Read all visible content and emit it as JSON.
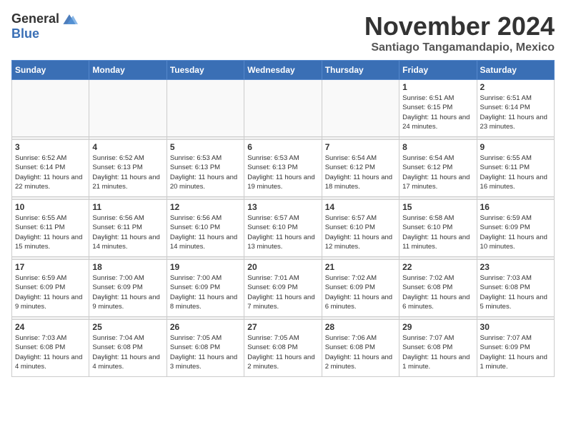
{
  "header": {
    "logo_general": "General",
    "logo_blue": "Blue",
    "month_title": "November 2024",
    "location": "Santiago Tangamandapio, Mexico"
  },
  "weekdays": [
    "Sunday",
    "Monday",
    "Tuesday",
    "Wednesday",
    "Thursday",
    "Friday",
    "Saturday"
  ],
  "weeks": [
    [
      {
        "day": "",
        "info": ""
      },
      {
        "day": "",
        "info": ""
      },
      {
        "day": "",
        "info": ""
      },
      {
        "day": "",
        "info": ""
      },
      {
        "day": "",
        "info": ""
      },
      {
        "day": "1",
        "info": "Sunrise: 6:51 AM\nSunset: 6:15 PM\nDaylight: 11 hours and 24 minutes."
      },
      {
        "day": "2",
        "info": "Sunrise: 6:51 AM\nSunset: 6:14 PM\nDaylight: 11 hours and 23 minutes."
      }
    ],
    [
      {
        "day": "3",
        "info": "Sunrise: 6:52 AM\nSunset: 6:14 PM\nDaylight: 11 hours and 22 minutes."
      },
      {
        "day": "4",
        "info": "Sunrise: 6:52 AM\nSunset: 6:13 PM\nDaylight: 11 hours and 21 minutes."
      },
      {
        "day": "5",
        "info": "Sunrise: 6:53 AM\nSunset: 6:13 PM\nDaylight: 11 hours and 20 minutes."
      },
      {
        "day": "6",
        "info": "Sunrise: 6:53 AM\nSunset: 6:13 PM\nDaylight: 11 hours and 19 minutes."
      },
      {
        "day": "7",
        "info": "Sunrise: 6:54 AM\nSunset: 6:12 PM\nDaylight: 11 hours and 18 minutes."
      },
      {
        "day": "8",
        "info": "Sunrise: 6:54 AM\nSunset: 6:12 PM\nDaylight: 11 hours and 17 minutes."
      },
      {
        "day": "9",
        "info": "Sunrise: 6:55 AM\nSunset: 6:11 PM\nDaylight: 11 hours and 16 minutes."
      }
    ],
    [
      {
        "day": "10",
        "info": "Sunrise: 6:55 AM\nSunset: 6:11 PM\nDaylight: 11 hours and 15 minutes."
      },
      {
        "day": "11",
        "info": "Sunrise: 6:56 AM\nSunset: 6:11 PM\nDaylight: 11 hours and 14 minutes."
      },
      {
        "day": "12",
        "info": "Sunrise: 6:56 AM\nSunset: 6:10 PM\nDaylight: 11 hours and 14 minutes."
      },
      {
        "day": "13",
        "info": "Sunrise: 6:57 AM\nSunset: 6:10 PM\nDaylight: 11 hours and 13 minutes."
      },
      {
        "day": "14",
        "info": "Sunrise: 6:57 AM\nSunset: 6:10 PM\nDaylight: 11 hours and 12 minutes."
      },
      {
        "day": "15",
        "info": "Sunrise: 6:58 AM\nSunset: 6:10 PM\nDaylight: 11 hours and 11 minutes."
      },
      {
        "day": "16",
        "info": "Sunrise: 6:59 AM\nSunset: 6:09 PM\nDaylight: 11 hours and 10 minutes."
      }
    ],
    [
      {
        "day": "17",
        "info": "Sunrise: 6:59 AM\nSunset: 6:09 PM\nDaylight: 11 hours and 9 minutes."
      },
      {
        "day": "18",
        "info": "Sunrise: 7:00 AM\nSunset: 6:09 PM\nDaylight: 11 hours and 9 minutes."
      },
      {
        "day": "19",
        "info": "Sunrise: 7:00 AM\nSunset: 6:09 PM\nDaylight: 11 hours and 8 minutes."
      },
      {
        "day": "20",
        "info": "Sunrise: 7:01 AM\nSunset: 6:09 PM\nDaylight: 11 hours and 7 minutes."
      },
      {
        "day": "21",
        "info": "Sunrise: 7:02 AM\nSunset: 6:09 PM\nDaylight: 11 hours and 6 minutes."
      },
      {
        "day": "22",
        "info": "Sunrise: 7:02 AM\nSunset: 6:08 PM\nDaylight: 11 hours and 6 minutes."
      },
      {
        "day": "23",
        "info": "Sunrise: 7:03 AM\nSunset: 6:08 PM\nDaylight: 11 hours and 5 minutes."
      }
    ],
    [
      {
        "day": "24",
        "info": "Sunrise: 7:03 AM\nSunset: 6:08 PM\nDaylight: 11 hours and 4 minutes."
      },
      {
        "day": "25",
        "info": "Sunrise: 7:04 AM\nSunset: 6:08 PM\nDaylight: 11 hours and 4 minutes."
      },
      {
        "day": "26",
        "info": "Sunrise: 7:05 AM\nSunset: 6:08 PM\nDaylight: 11 hours and 3 minutes."
      },
      {
        "day": "27",
        "info": "Sunrise: 7:05 AM\nSunset: 6:08 PM\nDaylight: 11 hours and 2 minutes."
      },
      {
        "day": "28",
        "info": "Sunrise: 7:06 AM\nSunset: 6:08 PM\nDaylight: 11 hours and 2 minutes."
      },
      {
        "day": "29",
        "info": "Sunrise: 7:07 AM\nSunset: 6:08 PM\nDaylight: 11 hours and 1 minute."
      },
      {
        "day": "30",
        "info": "Sunrise: 7:07 AM\nSunset: 6:09 PM\nDaylight: 11 hours and 1 minute."
      }
    ]
  ]
}
